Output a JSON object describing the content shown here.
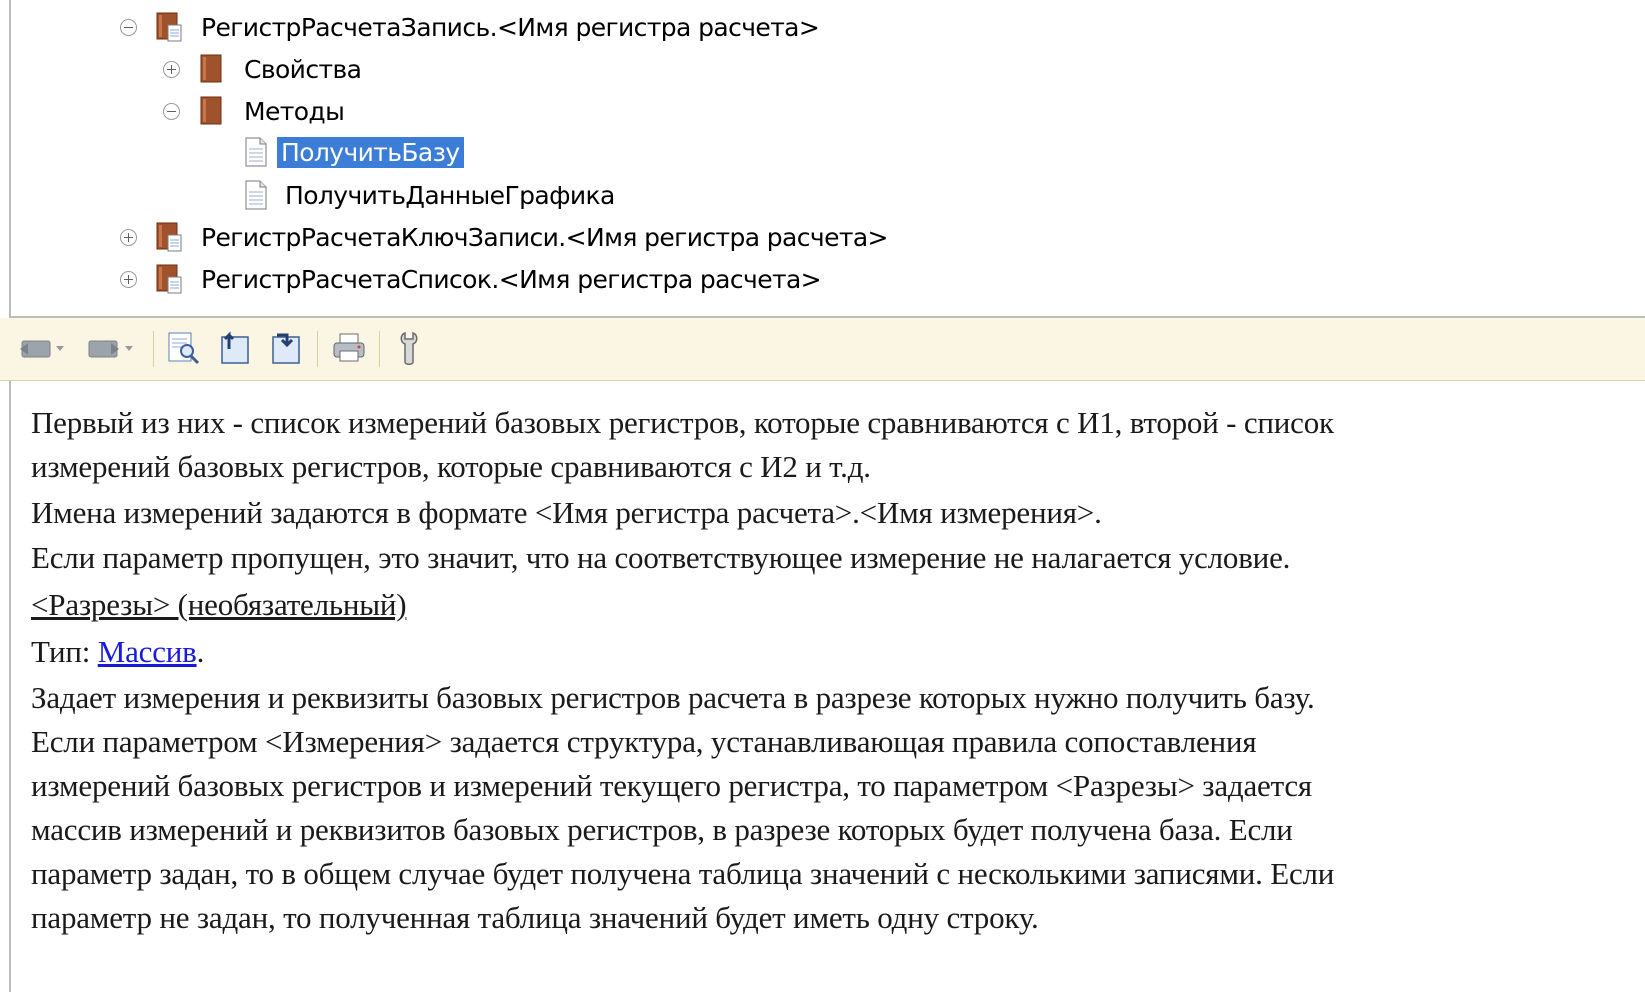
{
  "tree": {
    "items": [
      {
        "label": "РегистрРасчетаЗапись.<Имя регистра расчета>",
        "state": "expanded",
        "icon": "book-icon"
      },
      {
        "label": "Свойства",
        "state": "collapsed",
        "icon": "book-icon"
      },
      {
        "label": "Методы",
        "state": "expanded",
        "icon": "book-icon"
      },
      {
        "label": "ПолучитьБазу",
        "state": "leaf",
        "icon": "page-icon",
        "selected": true
      },
      {
        "label": "ПолучитьДанныеГрафика",
        "state": "leaf",
        "icon": "page-icon"
      },
      {
        "label": "РегистрРасчетаКлючЗаписи.<Имя регистра расчета>",
        "state": "collapsed",
        "icon": "book-icon"
      },
      {
        "label": "РегистрРасчетаСписок.<Имя регистра расчета>",
        "state": "collapsed",
        "icon": "book-icon"
      }
    ]
  },
  "toolbar": {
    "buttons": [
      "back-icon",
      "forward-icon",
      "find-icon",
      "go-up-icon",
      "sync-icon",
      "print-icon",
      "settings-icon"
    ]
  },
  "help": {
    "line1": "Первый из них - список измерений базовых регистров, которые сравниваются с И1, второй - список",
    "line2": "измерений базовых регистров, которые сравниваются с И2 и т.д.",
    "line3": "Имена измерений задаются в формате <Имя регистра расчета>.<Имя измерения>.",
    "line4": "Если параметр пропущен, это значит, что на соответствующее измерение не налагается условие.",
    "param_heading": "<Разрезы> (необязательный)",
    "type_prefix": "Тип: ",
    "type_link": "Массив",
    "type_suffix": ".",
    "line7": "Задает измерения и реквизиты базовых регистров расчета в разрезе которых нужно получить базу.",
    "line8": "Если параметром <Измерения> задается структура, устанавливающая правила сопоставления",
    "line9": "измерений базовых регистров и измерений текущего регистра, то параметром <Разрезы> задается",
    "line10": "массив измерений и реквизитов базовых регистров, в разрезе которых будет получена база. Если",
    "line11": "параметр задан, то в общем случае будет получена таблица значений с несколькими записями. Если",
    "line12": "параметр не задан, то полученная таблица значений будет иметь одну строку."
  }
}
